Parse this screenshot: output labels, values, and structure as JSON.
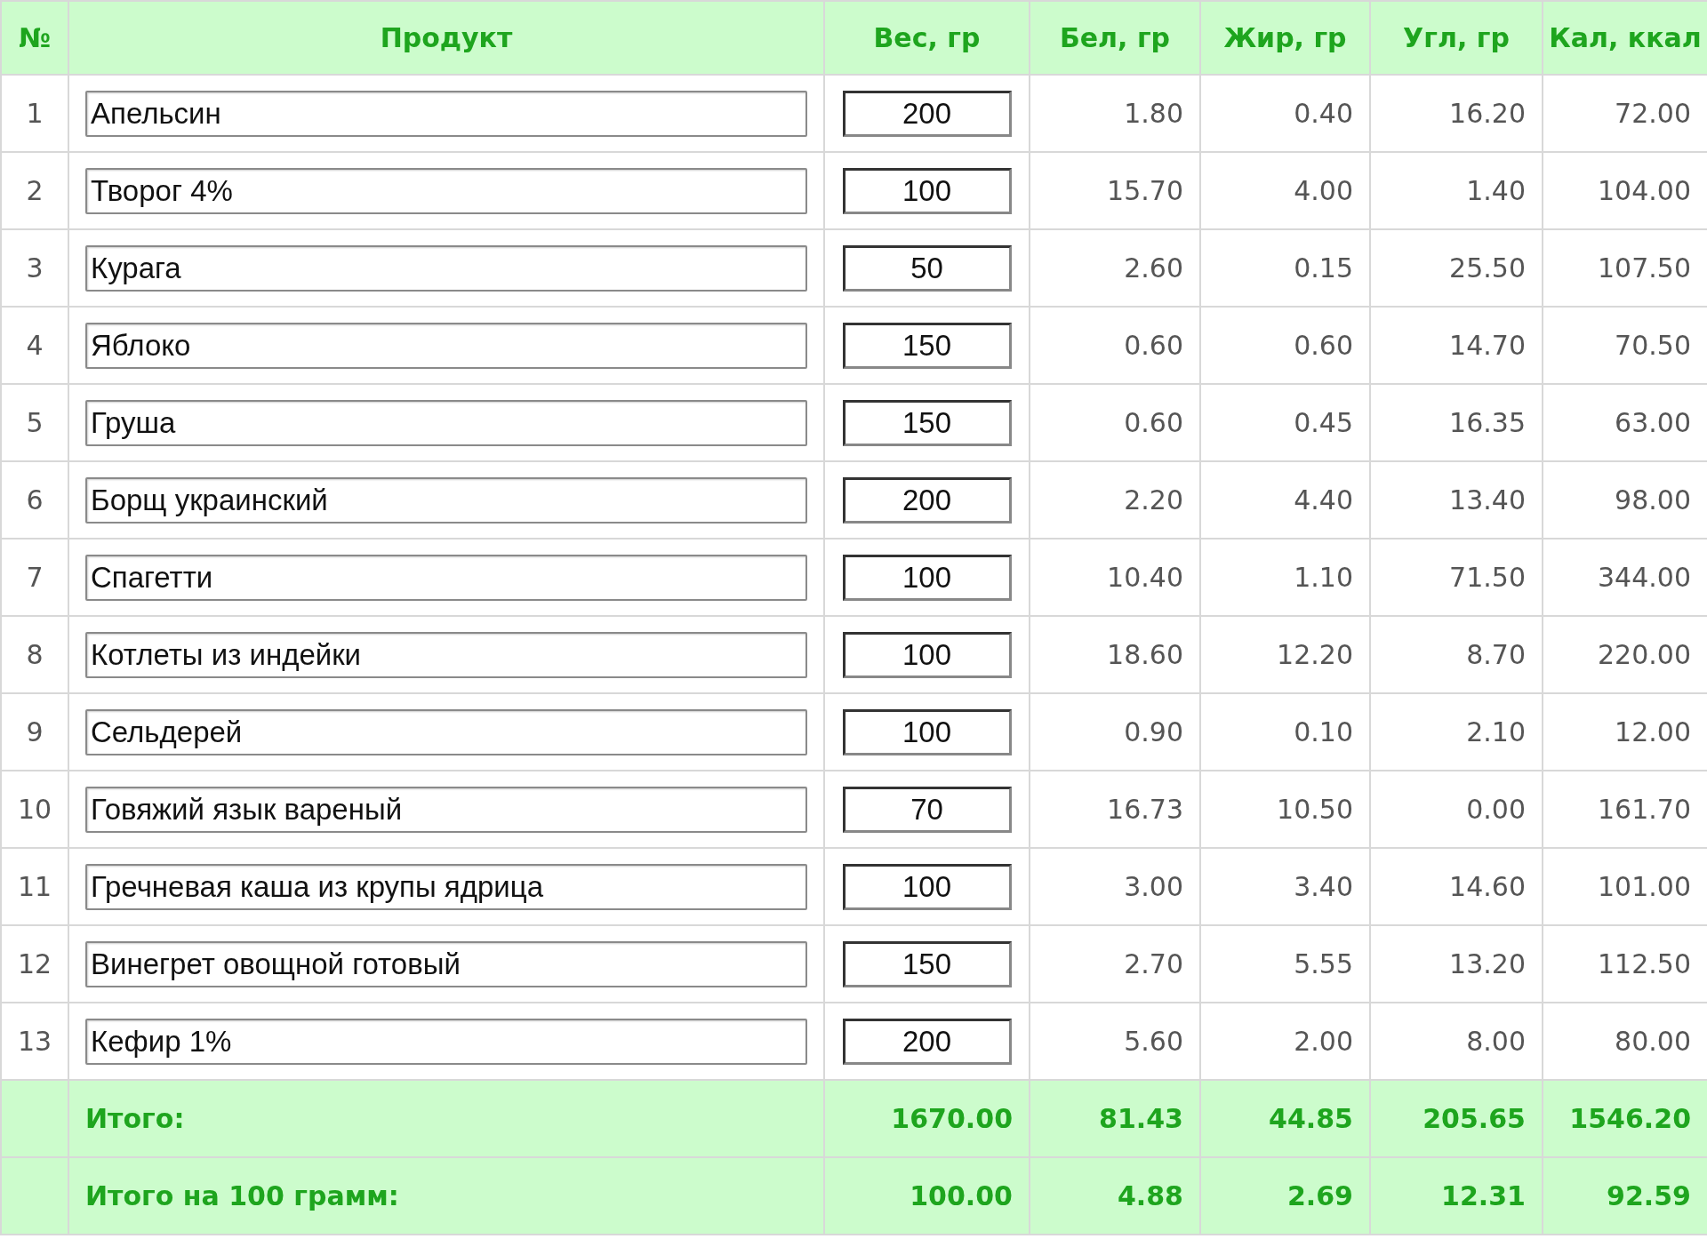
{
  "columns": [
    "№",
    "Продукт",
    "Вес, гр",
    "Бел, гр",
    "Жир, гр",
    "Угл, гр",
    "Кал, ккал"
  ],
  "rows": [
    {
      "number": "1",
      "product": "Апельсин",
      "weight": "200",
      "protein": "1.80",
      "fat": "0.40",
      "carbs": "16.20",
      "kcal": "72.00"
    },
    {
      "number": "2",
      "product": "Творог 4%",
      "weight": "100",
      "protein": "15.70",
      "fat": "4.00",
      "carbs": "1.40",
      "kcal": "104.00"
    },
    {
      "number": "3",
      "product": "Курага",
      "weight": "50",
      "protein": "2.60",
      "fat": "0.15",
      "carbs": "25.50",
      "kcal": "107.50"
    },
    {
      "number": "4",
      "product": "Яблоко",
      "weight": "150",
      "protein": "0.60",
      "fat": "0.60",
      "carbs": "14.70",
      "kcal": "70.50"
    },
    {
      "number": "5",
      "product": "Груша",
      "weight": "150",
      "protein": "0.60",
      "fat": "0.45",
      "carbs": "16.35",
      "kcal": "63.00"
    },
    {
      "number": "6",
      "product": "Борщ украинский",
      "weight": "200",
      "protein": "2.20",
      "fat": "4.40",
      "carbs": "13.40",
      "kcal": "98.00"
    },
    {
      "number": "7",
      "product": "Спагетти",
      "weight": "100",
      "protein": "10.40",
      "fat": "1.10",
      "carbs": "71.50",
      "kcal": "344.00"
    },
    {
      "number": "8",
      "product": "Котлеты из индейки",
      "weight": "100",
      "protein": "18.60",
      "fat": "12.20",
      "carbs": "8.70",
      "kcal": "220.00"
    },
    {
      "number": "9",
      "product": "Сельдерей",
      "weight": "100",
      "protein": "0.90",
      "fat": "0.10",
      "carbs": "2.10",
      "kcal": "12.00"
    },
    {
      "number": "10",
      "product": "Говяжий язык вареный",
      "weight": "70",
      "protein": "16.73",
      "fat": "10.50",
      "carbs": "0.00",
      "kcal": "161.70"
    },
    {
      "number": "11",
      "product": "Гречневая каша из крупы ядрица",
      "weight": "100",
      "protein": "3.00",
      "fat": "3.40",
      "carbs": "14.60",
      "kcal": "101.00"
    },
    {
      "number": "12",
      "product": "Винегрет овощной готовый",
      "weight": "150",
      "protein": "2.70",
      "fat": "5.55",
      "carbs": "13.20",
      "kcal": "112.50"
    },
    {
      "number": "13",
      "product": "Кефир 1%",
      "weight": "200",
      "protein": "5.60",
      "fat": "2.00",
      "carbs": "8.00",
      "kcal": "80.00"
    }
  ],
  "totals": [
    {
      "label": "Итого:",
      "weight": "1670.00",
      "protein": "81.43",
      "fat": "44.85",
      "carbs": "205.65",
      "kcal": "1546.20"
    },
    {
      "label": "Итого на 100 грамм:",
      "weight": "100.00",
      "protein": "4.88",
      "fat": "2.69",
      "carbs": "12.31",
      "kcal": "92.59"
    }
  ]
}
